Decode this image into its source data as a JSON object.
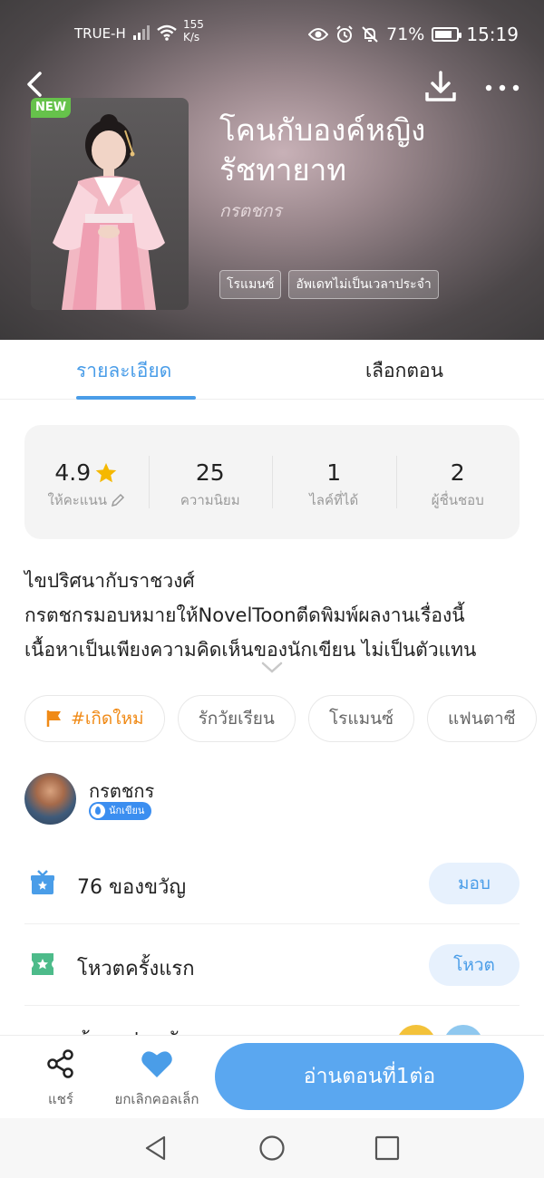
{
  "status_bar": {
    "carrier": "TRUE-H",
    "speed_value": "155",
    "speed_unit": "K/s",
    "battery": "71%",
    "time": "15:19"
  },
  "hero": {
    "new_badge": "NEW",
    "title_line1": "โคนกับองค์หญิง",
    "title_line2": "รัชทายาท",
    "author": "กรตชกร",
    "tags": [
      "โรแมนซ์",
      "อัพเดทไม่เป็นเวลาประจำ"
    ]
  },
  "tabs": {
    "details": "รายละเอียด",
    "episodes": "เลือกตอน"
  },
  "stats": [
    {
      "value": "4.9",
      "label": "ให้คะแนน"
    },
    {
      "value": "25",
      "label": "ความนิยม"
    },
    {
      "value": "1",
      "label": "ไลค์ที่ได้"
    },
    {
      "value": "2",
      "label": "ผู้ชื่นชอบ"
    }
  ],
  "description": {
    "line1": "ไขปริศนากับราชวงศ์",
    "line2": "กรตชกรมอบหมายให้NovelToonตีดพิมพ์ผลงานเรื่องนี้",
    "line3": "เนื้อหาเป็นเพียงความคิดเห็นของนักเขียน ไม่เป็นตัวแทน"
  },
  "tag_pills": [
    "#เกิดใหม่",
    "รักวัยเรียน",
    "โรแมนซ์",
    "แฟนตาซี"
  ],
  "author": {
    "name": "กรตชกร",
    "badge": "นักเขียน"
  },
  "gift_row": {
    "label": "76 ของขวัญ",
    "button": "มอบ"
  },
  "vote_row": {
    "label": "โหวตครั้งแรก",
    "button": "โหวต"
  },
  "fan_row": {
    "label": "ห้องแฟนคลับ"
  },
  "bottom_bar": {
    "share": "แชร์",
    "favorite": "ยกเลิกคอลเล็ก",
    "read": "อ่านตอนที่1ต่อ"
  },
  "colors": {
    "accent": "#4a9de8",
    "read_button": "#5aa7f0",
    "star": "#f5b800",
    "hot_tag": "#f08a16",
    "new_badge": "#66c24b"
  }
}
